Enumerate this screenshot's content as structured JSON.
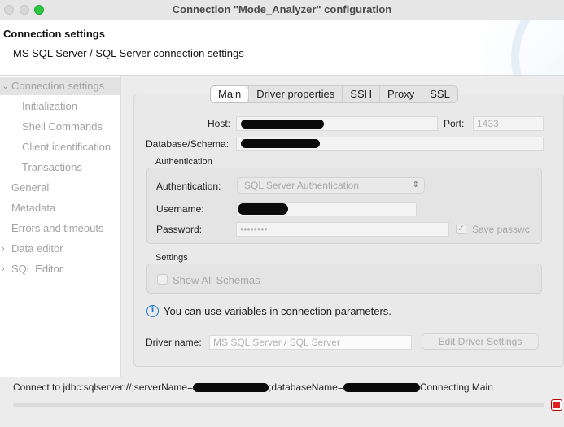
{
  "window": {
    "title": "Connection \"Mode_Analyzer\" configuration"
  },
  "header": {
    "title": "Connection settings",
    "subtitle": "MS SQL Server / SQL Server connection settings"
  },
  "sidebar": {
    "items": [
      {
        "label": "Connection settings",
        "selected": true,
        "expandable": true
      },
      {
        "label": "Initialization"
      },
      {
        "label": "Shell Commands"
      },
      {
        "label": "Client identification"
      },
      {
        "label": "Transactions"
      },
      {
        "label": "General"
      },
      {
        "label": "Metadata"
      },
      {
        "label": "Errors and timeouts"
      },
      {
        "label": "Data editor",
        "expandable": true
      },
      {
        "label": "SQL Editor",
        "expandable": true
      }
    ]
  },
  "tabs": [
    "Main",
    "Driver properties",
    "SSH",
    "Proxy",
    "SSL"
  ],
  "active_tab": "Main",
  "form": {
    "host_label": "Host:",
    "host_value": "",
    "port_label": "Port:",
    "port_value": "1433",
    "database_label": "Database/Schema:",
    "database_value": "",
    "auth_group_title": "Authentication",
    "auth_label": "Authentication:",
    "auth_value": "SQL Server Authentication",
    "username_label": "Username:",
    "username_value": "",
    "password_label": "Password:",
    "password_value": "••••••••",
    "save_password_label": "Save passwc",
    "save_password_checked": true,
    "settings_group_title": "Settings",
    "show_all_schemas_label": "Show All Schemas",
    "show_all_schemas_checked": false,
    "info_text": "You can use variables in connection parameters.",
    "driver_label": "Driver name:",
    "driver_value": "MS SQL Server / SQL Server",
    "edit_driver_button": "Edit Driver Settings"
  },
  "status": {
    "prefix": "Connect to jdbc:sqlserver://;serverName=",
    "middle": ";databaseName=",
    "suffix": "Connecting Main"
  },
  "colors": {
    "accent": "#1f78d1",
    "stop": "#e02020",
    "maximize": "#2bc840"
  },
  "icons": {
    "info": "info-circle-icon",
    "stop": "stop-icon",
    "chevron": "chevron-right-icon",
    "select_arrows": "updown-arrows-icon"
  }
}
